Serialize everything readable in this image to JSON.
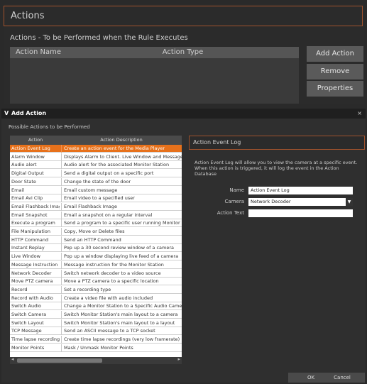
{
  "rule": {
    "panel_title": "Actions",
    "subtitle": "Actions - To be Performed when the Rule Executes",
    "columns": {
      "name": "Action Name",
      "type": "Action Type"
    },
    "buttons": {
      "add": "Add Action",
      "remove": "Remove",
      "properties": "Properties"
    }
  },
  "dialog": {
    "title": "Add Action",
    "chevron": "V",
    "close": "×",
    "possible_label": "Possible Actions to be Performed",
    "columns": {
      "action": "Action",
      "description": "Action Description"
    },
    "rows": [
      {
        "action": "Action Event Log",
        "description": "Create an action event for the Media Player",
        "selected": true
      },
      {
        "action": "Alarm Window",
        "description": "Displays Alarm to Client.  Live Window and Message"
      },
      {
        "action": "Audio alert",
        "description": "Audio alert for the associated Monitor Station"
      },
      {
        "action": "Digital Output",
        "description": "Send a digital output on a specific port"
      },
      {
        "action": "Door State",
        "description": "Change the state of the door"
      },
      {
        "action": "Email",
        "description": "Email custom message"
      },
      {
        "action": "Email Avi Clip",
        "description": "Email video to a specified user"
      },
      {
        "action": "Email Flashback Image",
        "description": "Email Flashback Image"
      },
      {
        "action": "Email Snapshot",
        "description": "Email a snapshot on a regular interval"
      },
      {
        "action": "Execute a program",
        "description": "Send a program to a specific user running Monitor Sta"
      },
      {
        "action": "File Manipulation",
        "description": "Copy, Move or Delete files"
      },
      {
        "action": "HTTP Command",
        "description": "Send an HTTP Command"
      },
      {
        "action": "Instant Replay",
        "description": "Pop up a 30 second review window of a camera"
      },
      {
        "action": "Live Window",
        "description": "Pop up a window displaying live feed of a camera"
      },
      {
        "action": "Message Instruction",
        "description": "Message instruction for the Monitor Station"
      },
      {
        "action": "Network Decoder",
        "description": "Switch network decoder to a video source"
      },
      {
        "action": "Move PTZ camera",
        "description": "Move a PTZ camera to a specific location"
      },
      {
        "action": "Record",
        "description": "Set a recording type"
      },
      {
        "action": "Record with Audio",
        "description": "Create a video file with audio included"
      },
      {
        "action": "Switch Audio",
        "description": "Change a Monitor Station to a Specific Audio Camera"
      },
      {
        "action": "Switch Camera",
        "description": "Switch Monitor Station's main layout to a camera"
      },
      {
        "action": "Switch Layout",
        "description": "Switch Monitor Station's main layout to a layout"
      },
      {
        "action": "TCP Message",
        "description": "Send an ASCII message to a TCP socket"
      },
      {
        "action": "Time lapse recording",
        "description": "Create time lapse recordings (very low framerate)"
      },
      {
        "action": "Monitor Points",
        "description": "Mask / Unmask Monitor Points"
      }
    ],
    "scroll": {
      "left": "◂",
      "right": "▸"
    },
    "detail": {
      "title": "Action Event Log",
      "description": "Action Event Log will allow you to view the camera at a specific event. When this action is triggered, it will log the event in the Action Database",
      "name_label": "Name",
      "name_value": "Action Event Log",
      "camera_label": "Camera",
      "camera_value": "Network Decoder",
      "camera_arrow": "▼",
      "action_text_label": "Action Text",
      "action_text_value": ""
    },
    "ok": "OK",
    "cancel": "Cancel"
  }
}
